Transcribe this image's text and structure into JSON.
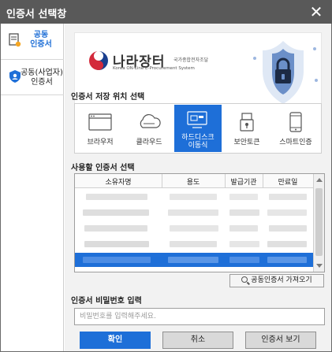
{
  "window": {
    "title": "인증서 선택창",
    "close_icon": "close-icon"
  },
  "sidebar": {
    "items": [
      {
        "label": "공동\n인증서",
        "icon": "certificate-icon",
        "active": true
      },
      {
        "label": "공동(사업자)\n인증서",
        "icon": "business-shield-icon",
        "active": false
      }
    ]
  },
  "banner": {
    "brand": "나라장터",
    "brand_small": "국가종합전자조달",
    "brand_sub": "Korea ON-Line E-Procurement System",
    "logo_icon": "taegeuk-logo-icon",
    "shield_icon": "shield-lock-icon"
  },
  "location": {
    "title": "인증서 저장 위치 선택",
    "options": [
      {
        "label": "브라우저",
        "icon": "browser-icon"
      },
      {
        "label": "클라우드",
        "icon": "cloud-icon"
      },
      {
        "label": "하드디스크\n이동식",
        "icon": "harddisk-icon",
        "selected": true
      },
      {
        "label": "보안토큰",
        "icon": "security-token-icon"
      },
      {
        "label": "스마트인증",
        "icon": "smartphone-icon"
      }
    ]
  },
  "certificates": {
    "title": "사용할 인증서 선택",
    "columns": [
      "소유자명",
      "용도",
      "발급기관",
      "만료일"
    ],
    "rows_note_hidden": "blurred"
  },
  "import_button": {
    "label": "공동인증서 가져오기",
    "icon": "search-icon"
  },
  "password": {
    "title": "인증서 비밀번호 입력",
    "placeholder": "비밀번호를 입력해주세요.",
    "value": ""
  },
  "buttons": {
    "ok": "확인",
    "cancel": "취소",
    "view": "인증서 보기"
  },
  "colors": {
    "accent": "#1e6fd8",
    "titlebar": "#595959",
    "panel_bg": "#f2f2f2"
  }
}
